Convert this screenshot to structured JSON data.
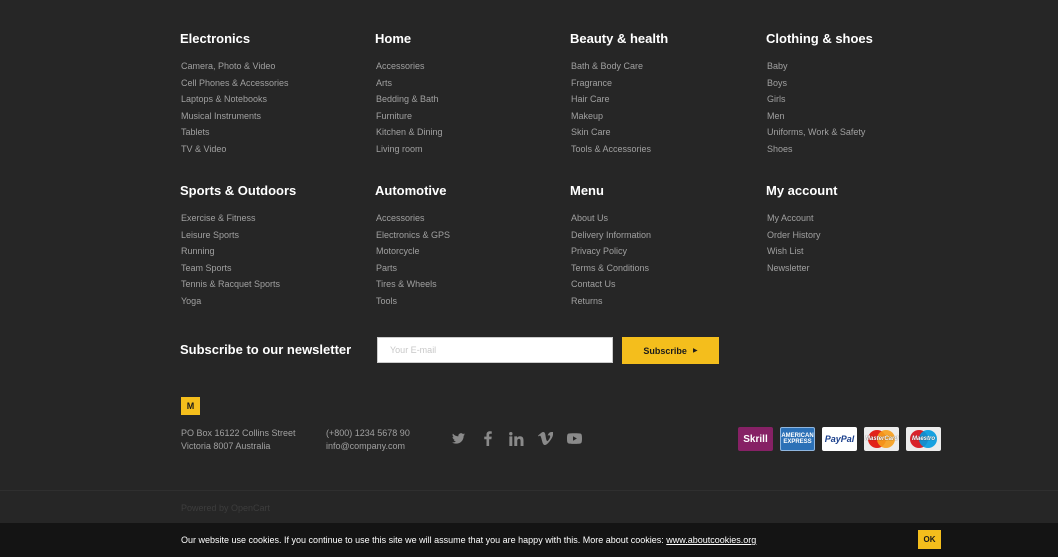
{
  "columns_row1": [
    {
      "title": "Electronics",
      "items": [
        "Camera, Photo & Video",
        "Cell Phones & Accessories",
        "Laptops & Notebooks",
        "Musical Instruments",
        "Tablets",
        "TV & Video"
      ]
    },
    {
      "title": "Home",
      "items": [
        "Accessories",
        "Arts",
        "Bedding & Bath",
        "Furniture",
        "Kitchen & Dining",
        "Living room"
      ]
    },
    {
      "title": "Beauty & health",
      "items": [
        "Bath & Body Care",
        "Fragrance",
        "Hair Care",
        "Makeup",
        "Skin Care",
        "Tools & Accessories"
      ]
    },
    {
      "title": "Clothing & shoes",
      "items": [
        "Baby",
        "Boys",
        "Girls",
        "Men",
        "Uniforms, Work & Safety",
        "Shoes"
      ]
    }
  ],
  "columns_row2": [
    {
      "title": "Sports & Outdoors",
      "items": [
        "Exercise & Fitness",
        "Leisure Sports",
        "Running",
        "Team Sports",
        "Tennis & Racquet Sports",
        "Yoga"
      ]
    },
    {
      "title": "Automotive",
      "items": [
        "Accessories",
        "Electronics & GPS",
        "Motorcycle",
        "Parts",
        "Tires & Wheels",
        "Tools"
      ]
    },
    {
      "title": "Menu",
      "items": [
        "About Us",
        "Delivery Information",
        "Privacy Policy",
        "Terms & Conditions",
        "Contact Us",
        "Returns"
      ]
    },
    {
      "title": "My account",
      "items": [
        "My Account",
        "Order History",
        "Wish List",
        "Newsletter"
      ]
    }
  ],
  "newsletter": {
    "title": "Subscribe to our newsletter",
    "placeholder": "Your E-mail",
    "button": "Subscribe",
    "button_icon": "caret-right-icon"
  },
  "logo": {
    "letter": "M"
  },
  "contact": {
    "address_line1": "PO Box 16122 Collins Street",
    "address_line2": "Victoria 8007 Australia",
    "phone": "(+800) 1234 5678 90",
    "email": "info@company.com"
  },
  "social": [
    "twitter-icon",
    "facebook-icon",
    "linkedin-icon",
    "vimeo-icon",
    "youtube-icon"
  ],
  "payments": {
    "skrill": "Skrill",
    "amex_line1": "AMERICAN",
    "amex_line2": "EXPRESS",
    "paypal": "PayPal",
    "mastercard": "MasterCard",
    "maestro": "Maestro"
  },
  "powered": "Powered by OpenCart",
  "cookie": {
    "message": "Our website use cookies. If you continue to use this site we will assume that you are happy with this. More about cookies:",
    "link": "www.aboutcookies.org",
    "ok": "OK"
  },
  "colors": {
    "background": "#262626",
    "accent": "#f4be1c",
    "cookie_bar": "#141414"
  }
}
